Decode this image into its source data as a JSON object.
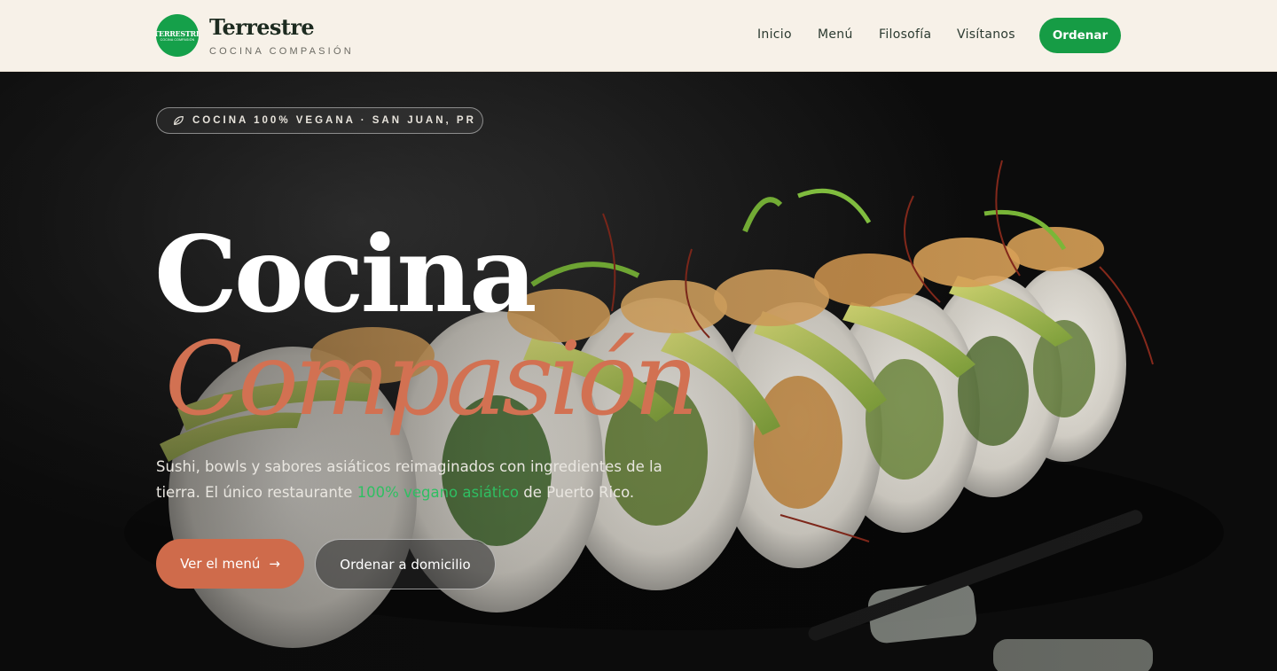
{
  "brand": {
    "badge_title": "TERRESTRE",
    "badge_sub": "COCINA COMPASIÓN",
    "name": "Terrestre",
    "tagline": "COCINA COMPASIÓN"
  },
  "nav": {
    "items": [
      "Inicio",
      "Menú",
      "Filosofía",
      "Visítanos"
    ],
    "order_label": "Ordenar"
  },
  "hero": {
    "pill_icon": "leaf-icon",
    "pill_text": "COCINA 100% VEGANA · SAN JUAN, PR",
    "title_line1": "Cocina",
    "title_line2": "Compasión",
    "lead_before": "Sushi, bowls y sabores asiáticos reimaginados con ingredientes de la tierra. El único restaurante ",
    "lead_highlight": "100% vegano asiático",
    "lead_after": " de Puerto Rico.",
    "primary_button": "Ver el menú",
    "primary_button_icon": "arrow-right-icon",
    "secondary_button": "Ordenar a domicilio"
  },
  "colors": {
    "header_bg": "#f7f1e8",
    "brand_green": "#169c45",
    "accent_terracotta": "#cf6b4b",
    "highlight_green": "#2fbf62"
  }
}
